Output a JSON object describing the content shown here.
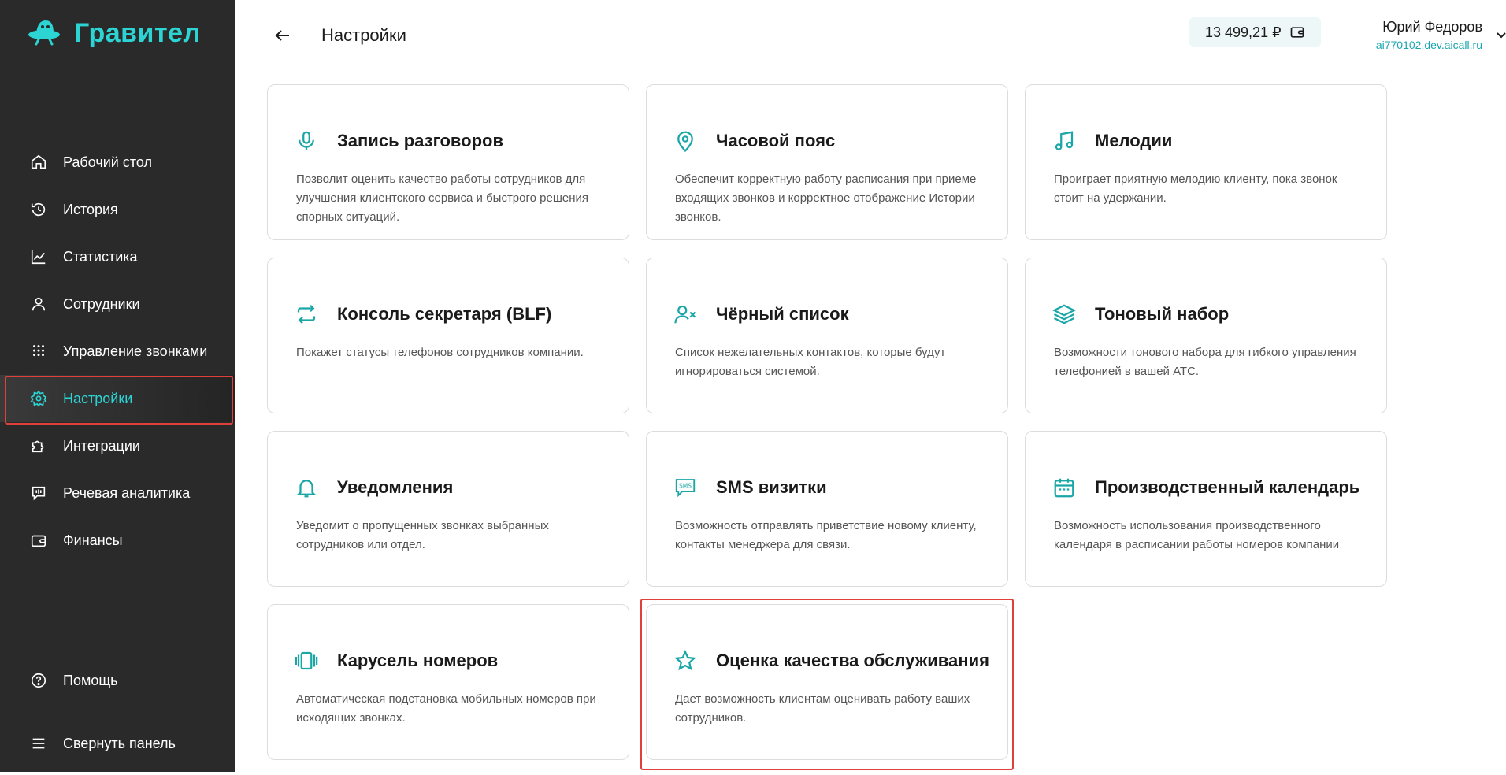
{
  "app": {
    "logo_text": "Гравител"
  },
  "sidebar": {
    "items": [
      {
        "label": "Рабочий стол",
        "icon": "home-icon"
      },
      {
        "label": "История",
        "icon": "history-icon"
      },
      {
        "label": "Статистика",
        "icon": "chart-icon"
      },
      {
        "label": "Сотрудники",
        "icon": "user-icon"
      },
      {
        "label": "Управление звонками",
        "icon": "dialpad-icon"
      },
      {
        "label": "Настройки",
        "icon": "gear-icon",
        "active": true
      },
      {
        "label": "Интеграции",
        "icon": "puzzle-icon"
      },
      {
        "label": "Речевая аналитика",
        "icon": "speech-icon"
      },
      {
        "label": "Финансы",
        "icon": "wallet-icon"
      }
    ],
    "help_label": "Помощь",
    "collapse_label": "Свернуть панель"
  },
  "header": {
    "title": "Настройки",
    "balance": "13 499,21 ₽",
    "user_name": "Юрий Федоров",
    "user_domain": "ai770102.dev.aicall.ru"
  },
  "cards": [
    {
      "title": "Запись разговоров",
      "desc": "Позволит оценить качество работы сотрудников для улучшения клиентского сервиса и быстрого решения спорных ситуаций.",
      "icon": "microphone-icon"
    },
    {
      "title": "Часовой пояс",
      "desc": "Обеспечит корректную работу расписания при приеме входящих звонков и корректное отображение Истории звонков.",
      "icon": "location-pin-icon"
    },
    {
      "title": "Мелодии",
      "desc": "Проиграет приятную мелодию клиенту, пока звонок стоит на удержании.",
      "icon": "music-note-icon"
    },
    {
      "title": "Консоль секретаря (BLF)",
      "desc": "Покажет статусы телефонов сотрудников компании.",
      "icon": "swap-arrows-icon"
    },
    {
      "title": "Чёрный список",
      "desc": "Список нежелательных контактов, которые будут игнорироваться системой.",
      "icon": "user-block-icon"
    },
    {
      "title": "Тоновый набор",
      "desc": "Возможности тонового набора для гибкого управления телефонией в вашей АТС.",
      "icon": "layers-icon"
    },
    {
      "title": "Уведомления",
      "desc": "Уведомит о пропущенных звонках выбранных сотрудников или отдел.",
      "icon": "bell-icon"
    },
    {
      "title": "SMS визитки",
      "desc": "Возможность отправлять приветствие новому клиенту, контакты менеджера для связи.",
      "icon": "sms-icon"
    },
    {
      "title": "Производственный календарь",
      "desc": "Возможность использования производственного календаря в расписании работы номеров компании",
      "icon": "calendar-icon"
    },
    {
      "title": "Карусель номеров",
      "desc": "Автоматическая подстановка мобильных номеров при исходящих звонках.",
      "icon": "carousel-icon"
    },
    {
      "title": "Оценка качества обслуживания",
      "desc": "Дает возможность клиентам оценивать работу ваших сотрудников.",
      "icon": "star-icon",
      "highlighted": true
    }
  ],
  "colors": {
    "accent": "#2dd4d4",
    "icon_teal": "#1aa6a6",
    "sidebar_bg": "#2a2a2a",
    "highlight_border": "#e0403a"
  }
}
